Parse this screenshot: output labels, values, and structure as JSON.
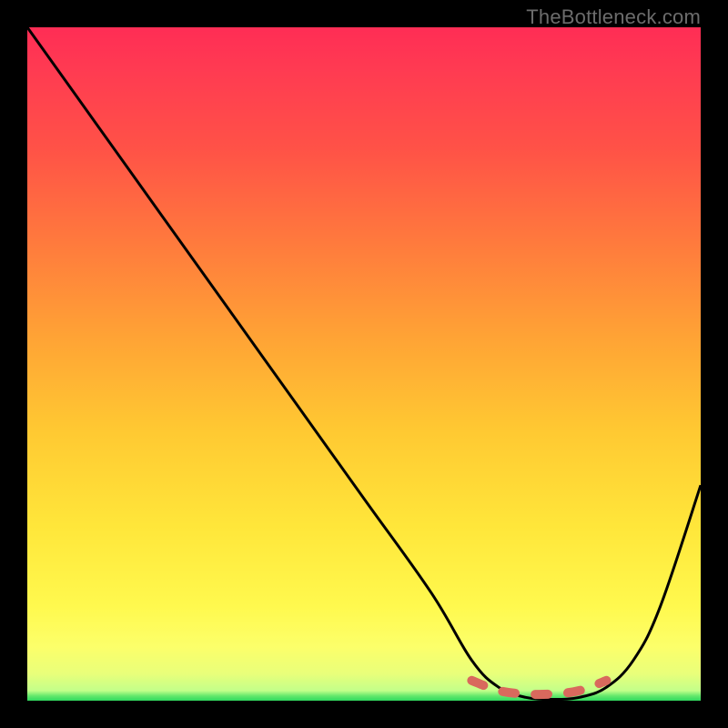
{
  "watermark": "TheBottleneck.com",
  "chart_data": {
    "type": "line",
    "title": "",
    "xlabel": "",
    "ylabel": "",
    "xlim": [
      0,
      100
    ],
    "ylim": [
      0,
      100
    ],
    "grid": false,
    "series": [
      {
        "name": "bottleneck-curve",
        "x": [
          0,
          10,
          20,
          30,
          40,
          50,
          60,
          66,
          70,
          74,
          78,
          82,
          86,
          90,
          94,
          100
        ],
        "y": [
          100,
          86,
          72,
          58,
          44,
          30,
          16,
          6,
          2,
          0.5,
          0.2,
          0.5,
          2,
          6,
          14,
          32
        ],
        "color": "#000000"
      },
      {
        "name": "optimal-range-marker",
        "x": [
          66,
          70,
          74,
          78,
          82,
          86
        ],
        "y": [
          3,
          1.5,
          1,
          1,
          1.5,
          3
        ],
        "color": "#d9695d",
        "style": "dashed-thick"
      }
    ],
    "annotations": []
  },
  "colors": {
    "background": "#000000",
    "gradient_top": "#ff2d55",
    "gradient_mid": "#ffe63a",
    "gradient_bottom": "#2fd85e",
    "curve": "#000000",
    "marker": "#d9695d",
    "watermark": "#6c6c6c"
  }
}
